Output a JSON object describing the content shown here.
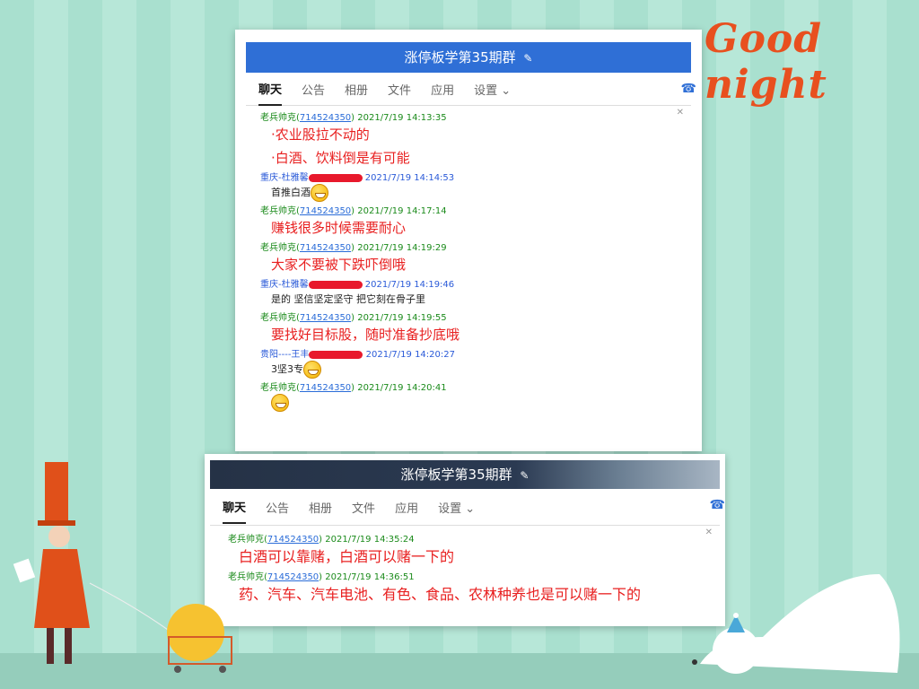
{
  "decor": {
    "goodnight": "Good night"
  },
  "panel1": {
    "title": "涨停板学第35期群",
    "tabs": [
      "聊天",
      "公告",
      "相册",
      "文件",
      "应用",
      "设置"
    ],
    "messages": [
      {
        "sender": "老兵帅克(",
        "qq": "714524350",
        "tail": ")",
        "time": "2021/7/19 14:13:35",
        "color": "green",
        "lines": [
          "·农业股拉不动的",
          "·白酒、饮料倒是有可能"
        ],
        "style": "red"
      },
      {
        "sender": "重庆-杜雅馨",
        "redacted": true,
        "time": "2021/7/19 14:14:53",
        "color": "blue",
        "lines": [
          "首推白酒"
        ],
        "style": "small",
        "emoji": true
      },
      {
        "sender": "老兵帅克(",
        "qq": "714524350",
        "tail": ")",
        "time": "2021/7/19 14:17:14",
        "color": "green",
        "lines": [
          "赚钱很多时候需要耐心"
        ],
        "style": "red"
      },
      {
        "sender": "老兵帅克(",
        "qq": "714524350",
        "tail": ")",
        "time": "2021/7/19 14:19:29",
        "color": "green",
        "lines": [
          "大家不要被下跌吓倒哦"
        ],
        "style": "red"
      },
      {
        "sender": "重庆-杜雅馨",
        "redacted": true,
        "time": "2021/7/19 14:19:46",
        "color": "blue",
        "lines": [
          "是的 坚信坚定坚守 把它刻在骨子里"
        ],
        "style": "small"
      },
      {
        "sender": "老兵帅克(",
        "qq": "714524350",
        "tail": ")",
        "time": "2021/7/19 14:19:55",
        "color": "green",
        "lines": [
          "要找好目标股，随时准备抄底哦"
        ],
        "style": "red"
      },
      {
        "sender": "贵阳----王丰",
        "redacted": true,
        "time": "2021/7/19 14:20:27",
        "color": "blue",
        "lines": [
          "3坚3专"
        ],
        "style": "small",
        "emoji": true
      },
      {
        "sender": "老兵帅克(",
        "qq": "714524350",
        "tail": ")",
        "time": "2021/7/19 14:20:41",
        "color": "green",
        "lines": [],
        "style": "small",
        "emoji": true
      }
    ]
  },
  "panel2": {
    "title": "涨停板学第35期群",
    "tabs": [
      "聊天",
      "公告",
      "相册",
      "文件",
      "应用",
      "设置"
    ],
    "messages": [
      {
        "sender": "老兵帅克(",
        "qq": "714524350",
        "tail": ")",
        "time": "2021/7/19 14:35:24",
        "color": "green",
        "lines": [
          "白酒可以靠赌，白酒可以赌一下的"
        ],
        "style": "red"
      },
      {
        "sender": "老兵帅克(",
        "qq": "714524350",
        "tail": ")",
        "time": "2021/7/19 14:36:51",
        "color": "green",
        "lines": [
          "药、汽车、汽车电池、有色、食品、农林种养也是可以赌一下的"
        ],
        "style": "red"
      }
    ]
  },
  "colors": {
    "titlebar1": "#2f6fd6",
    "titlebar2": "#2b3a52",
    "green": "#1a8a1a",
    "red": "#e82020"
  }
}
